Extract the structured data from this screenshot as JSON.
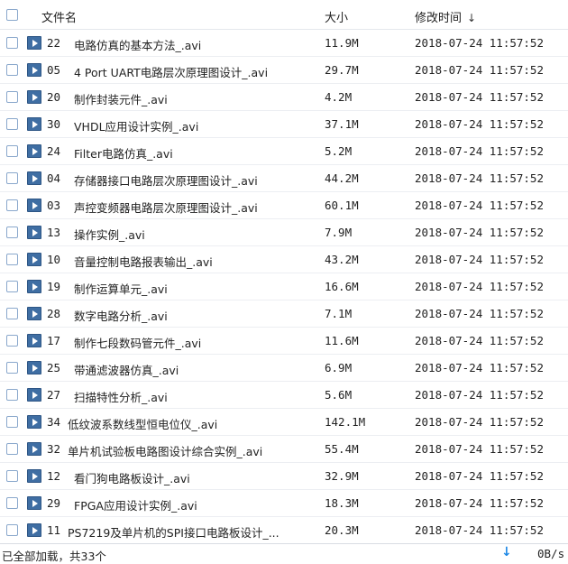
{
  "header": {
    "name_label": "文件名",
    "size_label": "大小",
    "time_label": "修改时间",
    "sort_icon": "arrow-down-icon"
  },
  "files": [
    {
      "num": "22",
      "name": "电路仿真的基本方法_.avi",
      "size": "11.9M",
      "time": "2018-07-24 11:57:52"
    },
    {
      "num": "05",
      "name": "4 Port UART电路层次原理图设计_.avi",
      "size": "29.7M",
      "time": "2018-07-24 11:57:52"
    },
    {
      "num": "20",
      "name": "制作封装元件_.avi",
      "size": "4.2M",
      "time": "2018-07-24 11:57:52"
    },
    {
      "num": "30",
      "name": "VHDL应用设计实例_.avi",
      "size": "37.1M",
      "time": "2018-07-24 11:57:52"
    },
    {
      "num": "24",
      "name": "Filter电路仿真_.avi",
      "size": "5.2M",
      "time": "2018-07-24 11:57:52"
    },
    {
      "num": "04",
      "name": "存储器接口电路层次原理图设计_.avi",
      "size": "44.2M",
      "time": "2018-07-24 11:57:52"
    },
    {
      "num": "03",
      "name": "声控变频器电路层次原理图设计_.avi",
      "size": "60.1M",
      "time": "2018-07-24 11:57:52"
    },
    {
      "num": "13",
      "name": "操作实例_.avi",
      "size": "7.9M",
      "time": "2018-07-24 11:57:52"
    },
    {
      "num": "10",
      "name": "音量控制电路报表输出_.avi",
      "size": "43.2M",
      "time": "2018-07-24 11:57:52"
    },
    {
      "num": "19",
      "name": "制作运算单元_.avi",
      "size": "16.6M",
      "time": "2018-07-24 11:57:52"
    },
    {
      "num": "28",
      "name": "数字电路分析_.avi",
      "size": "7.1M",
      "time": "2018-07-24 11:57:52"
    },
    {
      "num": "17",
      "name": "制作七段数码管元件_.avi",
      "size": "11.6M",
      "time": "2018-07-24 11:57:52"
    },
    {
      "num": "25",
      "name": "带通滤波器仿真_.avi",
      "size": "6.9M",
      "time": "2018-07-24 11:57:52"
    },
    {
      "num": "27",
      "name": "扫描特性分析_.avi",
      "size": "5.6M",
      "time": "2018-07-24 11:57:52"
    },
    {
      "num": "34",
      "name": "低纹波系数线型恒电位仪_.avi",
      "size": "142.1M",
      "time": "2018-07-24 11:57:52"
    },
    {
      "num": "32",
      "name": "单片机试验板电路图设计综合实例_.avi",
      "size": "55.4M",
      "time": "2018-07-24 11:57:52"
    },
    {
      "num": "12",
      "name": "看门狗电路板设计_.avi",
      "size": "32.9M",
      "time": "2018-07-24 11:57:52"
    },
    {
      "num": "29",
      "name": "FPGA应用设计实例_.avi",
      "size": "18.3M",
      "time": "2018-07-24 11:57:52"
    },
    {
      "num": "11",
      "name": "PS7219及单片机的SPI接口电路板设计_...",
      "size": "20.3M",
      "time": "2018-07-24 11:57:52"
    }
  ],
  "status": {
    "text": "已全部加载，共33个",
    "speed": "0B/s",
    "download_icon": "download-arrow-icon"
  }
}
